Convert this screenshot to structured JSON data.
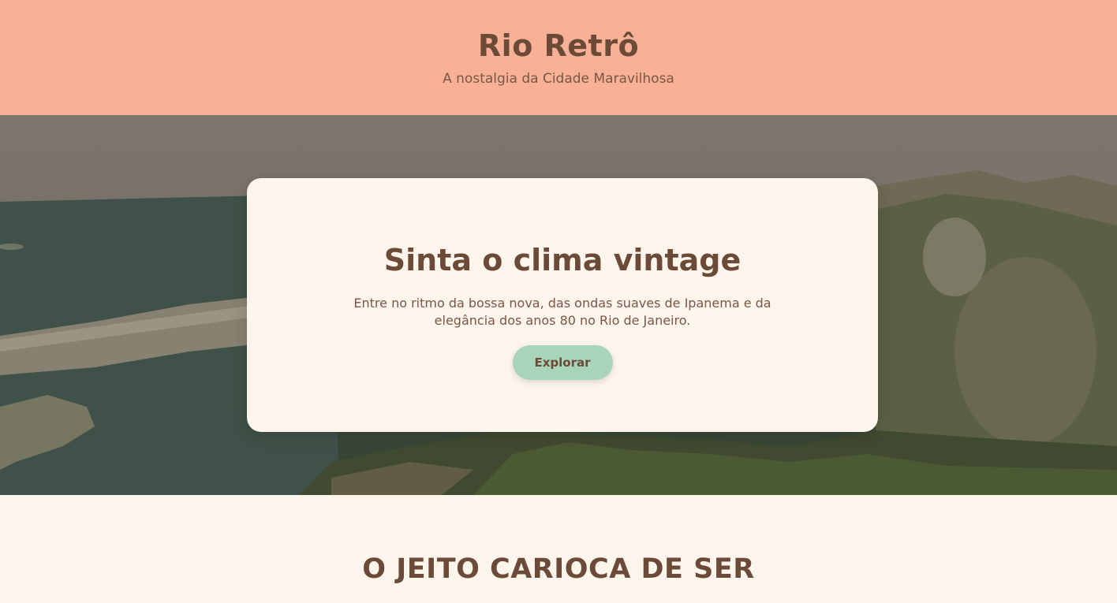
{
  "header": {
    "title": "Rio Retrô",
    "tagline": "A nostalgia da Cidade Maravilhosa"
  },
  "hero": {
    "heading": "Sinta o clima vintage",
    "text": "Entre no ritmo da bossa nova, das ondas suaves de Ipanema e da elegância dos anos 80 no Rio de Janeiro.",
    "button_label": "Explorar",
    "background_image": "aerial-view-rio-de-janeiro"
  },
  "section": {
    "title": "O JEITO CARIOCA DE SER"
  },
  "colors": {
    "header_bg": "#f8b196",
    "page_bg": "#fdf5ec",
    "text": "#6b4a38",
    "button_bg": "#a8d5ba"
  }
}
